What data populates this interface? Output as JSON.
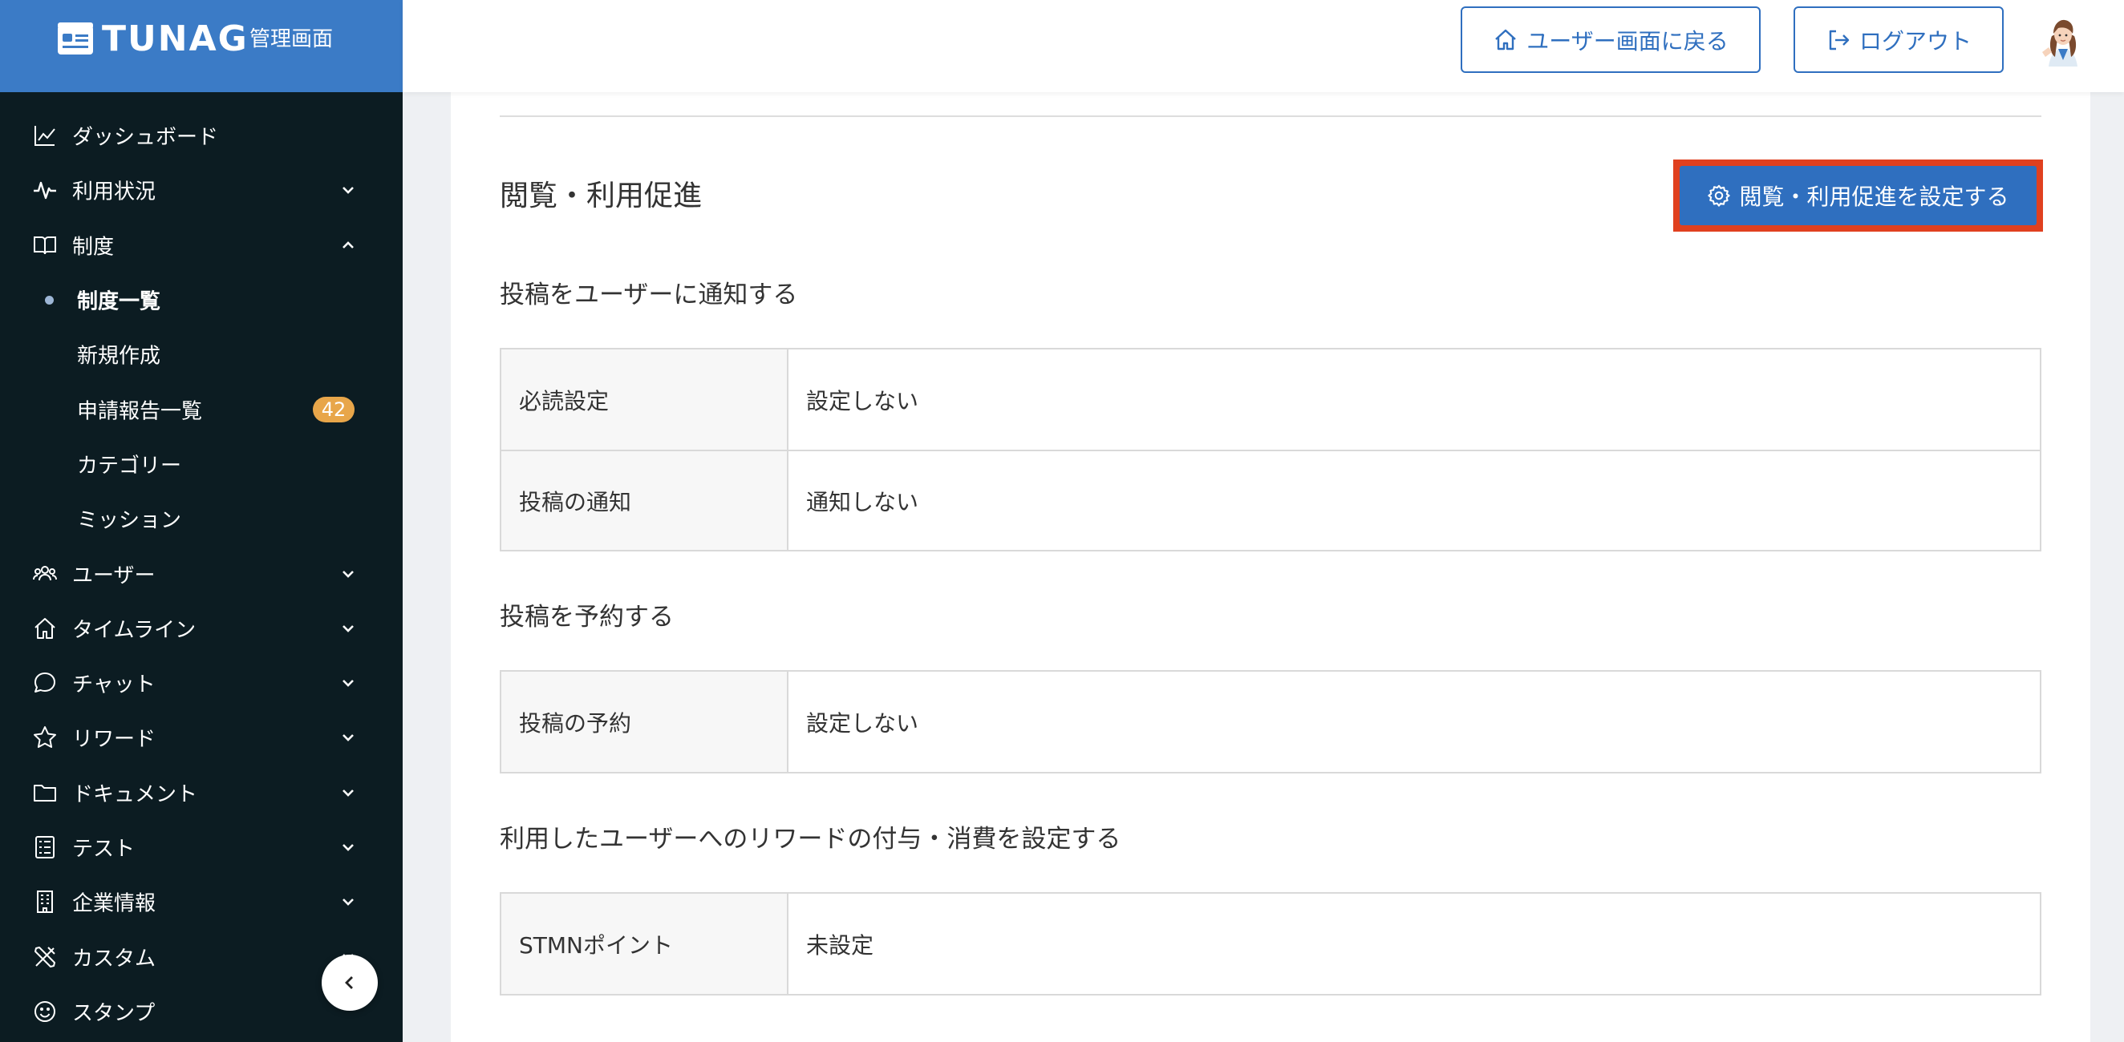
{
  "app": {
    "logo_text": "TUNAG",
    "logo_sub": "管理画面"
  },
  "header": {
    "back_label": "ユーザー画面に戻る",
    "logout_label": "ログアウト"
  },
  "sidebar": {
    "items": [
      {
        "label": "ダッシュボード",
        "icon": "chart-line-icon"
      },
      {
        "label": "利用状況",
        "icon": "activity-icon",
        "expanded": false
      },
      {
        "label": "制度",
        "icon": "book-icon",
        "expanded": true
      },
      {
        "label": "制度一覧",
        "active": true
      },
      {
        "label": "新規作成"
      },
      {
        "label": "申請報告一覧",
        "badge": "42"
      },
      {
        "label": "カテゴリー"
      },
      {
        "label": "ミッション"
      },
      {
        "label": "ユーザー",
        "icon": "users-icon",
        "expanded": false
      },
      {
        "label": "タイムライン",
        "icon": "home-icon",
        "expanded": false
      },
      {
        "label": "チャット",
        "icon": "chat-bubble-icon",
        "expanded": false
      },
      {
        "label": "リワード",
        "icon": "star-icon",
        "expanded": false
      },
      {
        "label": "ドキュメント",
        "icon": "folder-icon",
        "expanded": false
      },
      {
        "label": "テスト",
        "icon": "checklist-icon",
        "expanded": false
      },
      {
        "label": "企業情報",
        "icon": "building-icon",
        "expanded": false
      },
      {
        "label": "カスタム",
        "icon": "tools-icon",
        "expanded": false
      },
      {
        "label": "スタンプ",
        "icon": "smile-icon"
      }
    ]
  },
  "main": {
    "section_title": "閲覧・利用促進",
    "settings_button": "閲覧・利用促進を設定する",
    "groups": [
      {
        "title": "投稿をユーザーに通知する",
        "rows": [
          {
            "label": "必読設定",
            "value": "設定しない"
          },
          {
            "label": "投稿の通知",
            "value": "通知しない"
          }
        ]
      },
      {
        "title": "投稿を予約する",
        "rows": [
          {
            "label": "投稿の予約",
            "value": "設定しない"
          }
        ]
      },
      {
        "title": "利用したユーザーへのリワードの付与・消費を設定する",
        "rows": [
          {
            "label": "STMNポイント",
            "value": "未設定"
          }
        ]
      }
    ]
  },
  "colors": {
    "sidebar_bg": "#0c1c22",
    "brand_blue": "#3b7bc6",
    "primary": "#2f6fbf",
    "highlight_border": "#e0401f",
    "badge": "#e8a64a"
  }
}
